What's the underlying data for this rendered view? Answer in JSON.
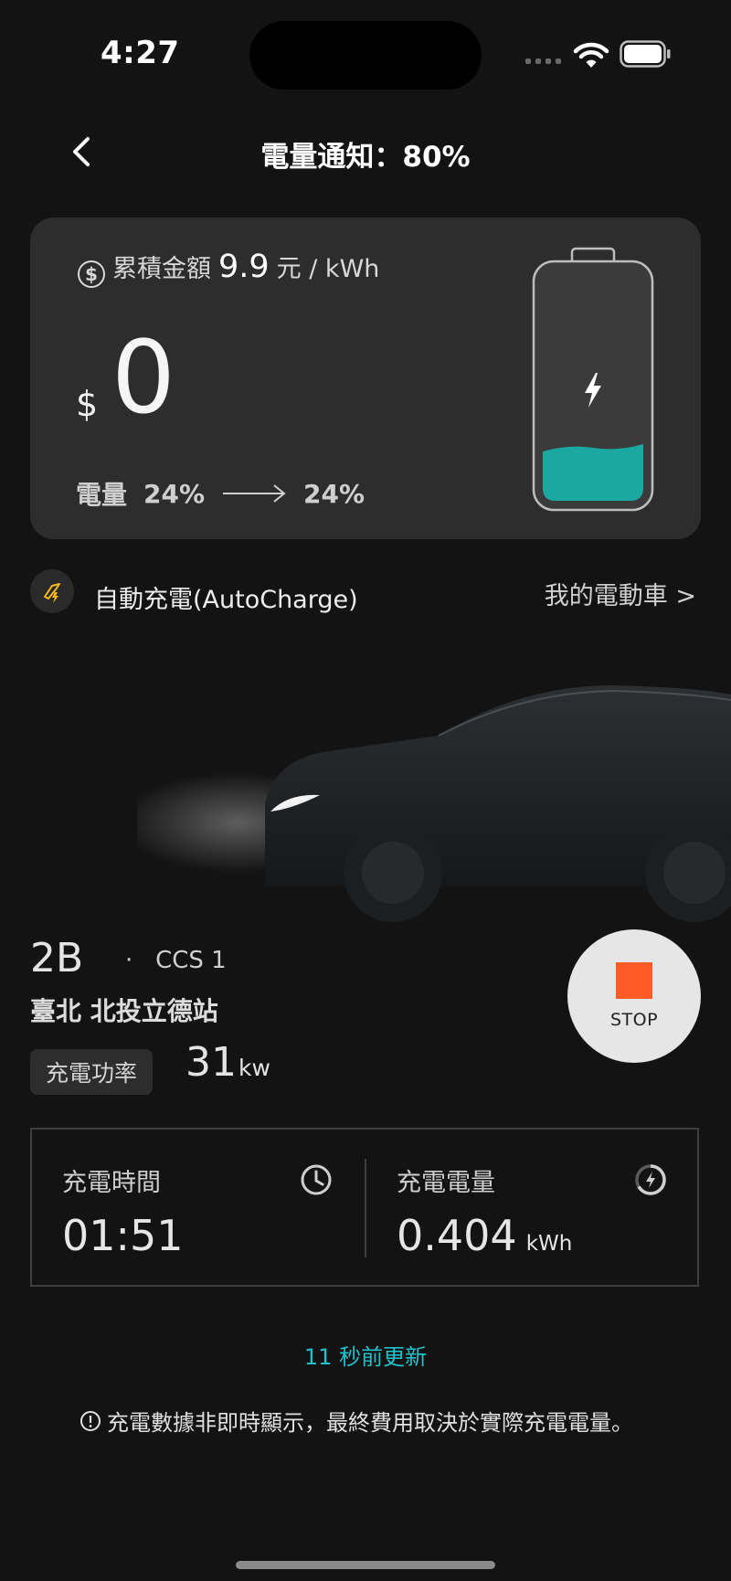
{
  "status_bar": {
    "time": "4:27"
  },
  "header": {
    "title": "電量通知：80%"
  },
  "card": {
    "rate_label": "累積金額",
    "rate_value": "9.9",
    "rate_unit": "元 / kWh",
    "currency_symbol": "$",
    "amount": "0",
    "battery_label": "電量",
    "battery_from": "24%",
    "battery_to": "24%",
    "battery_level": 0.24
  },
  "autocharge": {
    "label": "自動充電(AutoCharge)",
    "my_ev_link": "我的電動車 >"
  },
  "station": {
    "bay": "2B",
    "separator": "·",
    "connector": "CCS 1",
    "name": "臺北 北投立德站",
    "power_label": "充電功率",
    "power_value": "31",
    "power_unit": "kw"
  },
  "stop_button": {
    "label": "STOP"
  },
  "stats": {
    "time_label": "充電時間",
    "time_value": "01:51",
    "energy_label": "充電電量",
    "energy_value": "0.404",
    "energy_unit": "kWh"
  },
  "updated_text": "11 秒前更新",
  "disclaimer": "充電數據非即時顯示，最終費用取決於實際充電電量。",
  "colors": {
    "accent_teal": "#1aa8a0",
    "stop_orange": "#ff5b26",
    "update_cyan": "#21c1cc",
    "charge_yellow": "#f5b81b"
  },
  "icons": [
    "back-icon",
    "wifi-icon",
    "battery-icon",
    "dollar-icon",
    "arrow-right-icon",
    "bolt-icon",
    "autocharge-icon",
    "clock-icon",
    "gauge-icon",
    "info-icon"
  ]
}
